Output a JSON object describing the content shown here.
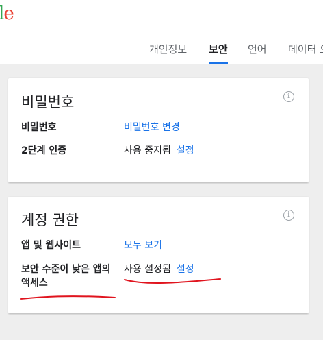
{
  "header": {
    "logo_letters": [
      "l",
      "e"
    ],
    "tabs": [
      {
        "label": "개인정보",
        "active": false
      },
      {
        "label": "보안",
        "active": true
      },
      {
        "label": "언어",
        "active": false
      },
      {
        "label": "데이터 오",
        "active": false
      }
    ]
  },
  "password_card": {
    "title": "비밀번호",
    "info_icon": "info-icon",
    "rows": [
      {
        "label": "비밀번호",
        "link": "비밀번호 변경"
      },
      {
        "label": "2단계 인증",
        "status": "사용 중지됨",
        "link": "설정"
      }
    ]
  },
  "access_card": {
    "title": "계정 권한",
    "info_icon": "info-icon",
    "rows": [
      {
        "label": "앱 및 웹사이트",
        "link": "모두 보기"
      },
      {
        "label": "보안 수준이 낮은 앱의 액세스",
        "status": "사용 설정됨",
        "link": "설정"
      }
    ]
  },
  "colors": {
    "accent": "#1a73e8",
    "annotation_red": "#e0141e",
    "page_background": "#eeeeee"
  }
}
